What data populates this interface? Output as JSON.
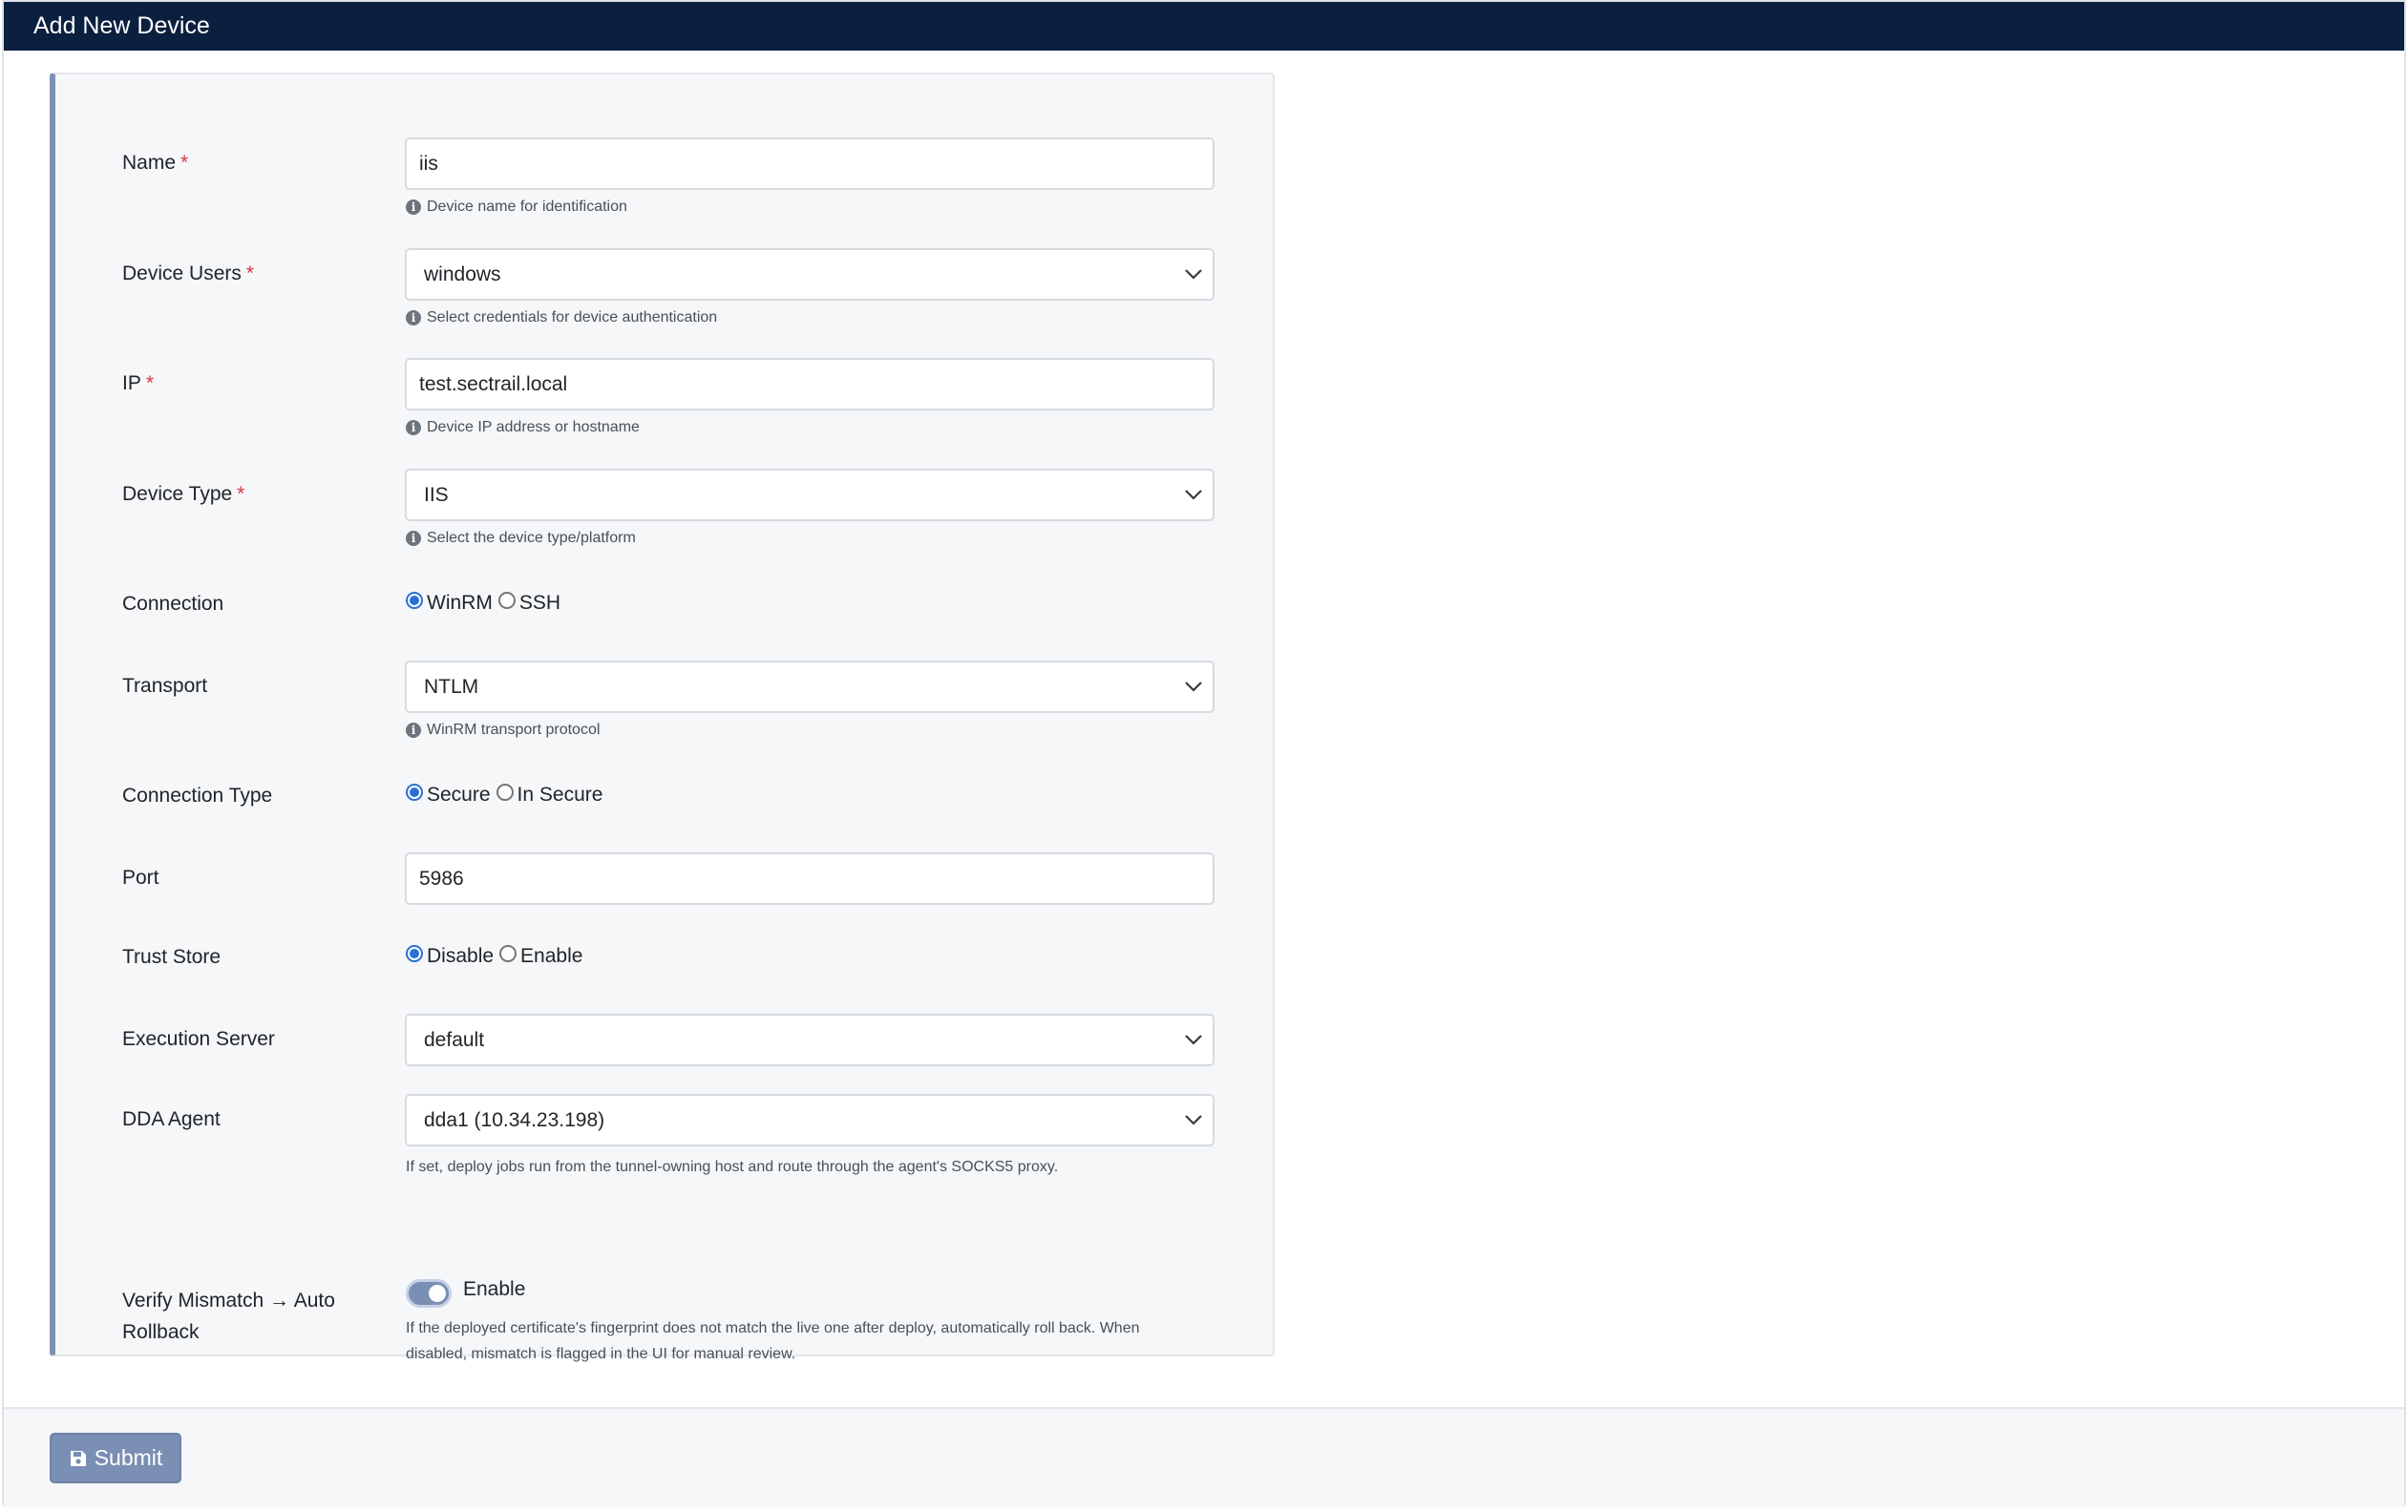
{
  "header": {
    "title": "Add New Device"
  },
  "form": {
    "required_mark": "*",
    "name": {
      "label": "Name",
      "value": "iis",
      "hint": "Device name for identification"
    },
    "device_users": {
      "label": "Device Users",
      "value": "windows",
      "hint": "Select credentials for device authentication"
    },
    "ip": {
      "label": "IP",
      "value": "test.sectrail.local",
      "hint": "Device IP address or hostname"
    },
    "device_type": {
      "label": "Device Type",
      "value": "IIS",
      "hint": "Select the device type/platform"
    },
    "connection": {
      "label": "Connection",
      "options": [
        "WinRM",
        "SSH"
      ],
      "selected": "WinRM"
    },
    "transport": {
      "label": "Transport",
      "value": "NTLM",
      "hint": "WinRM transport protocol"
    },
    "connection_type": {
      "label": "Connection Type",
      "options": [
        "Secure",
        "In Secure"
      ],
      "selected": "Secure"
    },
    "port": {
      "label": "Port",
      "value": "5986"
    },
    "trust_store": {
      "label": "Trust Store",
      "options": [
        "Disable",
        "Enable"
      ],
      "selected": "Disable"
    },
    "execution_server": {
      "label": "Execution Server",
      "value": "default"
    },
    "dda_agent": {
      "label": "DDA Agent",
      "value": "dda1 (10.34.23.198)",
      "hint": "If set, deploy jobs run from the tunnel-owning host and route through the agent's SOCKS5 proxy."
    },
    "verify_mismatch": {
      "label_line1": "Verify Mismatch → Auto",
      "label_line2": "Rollback",
      "toggle_label": "Enable",
      "enabled": true,
      "hint_line1": "If the deployed certificate's fingerprint does not match the live one after deploy, automatically roll back. When",
      "hint_line2": "disabled, mismatch is flagged in the UI for manual review."
    }
  },
  "footer": {
    "submit_label": "Submit"
  },
  "icons": {
    "info": "info-circle-icon",
    "chevron": "chevron-down-icon",
    "save": "floppy-disk-icon"
  },
  "colors": {
    "header_bg": "#0b1f3f",
    "accent": "#7a8fb3",
    "radio": "#2b6fd6",
    "required": "#dc3545"
  }
}
